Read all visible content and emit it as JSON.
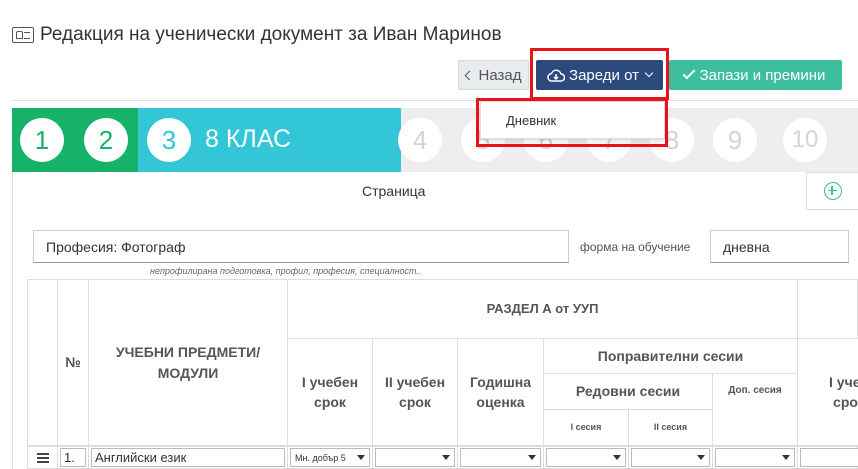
{
  "header": {
    "title": "Редакция на ученически документ за Иван Маринов",
    "title_icon": "id-card-icon"
  },
  "toolbar": {
    "back_label": "Назад",
    "load_label": "Зареди от",
    "save_label": "Запази и премини",
    "accent_save": "#3dbf9f",
    "accent_load": "#2d4a7c"
  },
  "dropdown": {
    "items": [
      "Дневник"
    ]
  },
  "steps": {
    "items": [
      "1",
      "2",
      "3",
      "4",
      "5",
      "6",
      "7",
      "8",
      "9",
      "10"
    ],
    "active_label": "8 КЛАС",
    "colors": {
      "done": "#17b26a",
      "active": "#33c6d6",
      "todo": "#eeeeee"
    }
  },
  "page": {
    "label": "Страница",
    "add_icon": "plus-circle-icon"
  },
  "form": {
    "profession_value": "Професия: Фотограф",
    "profession_hint": "непрофилирана подготовка, профил, професия, специалност..",
    "study_form_label": "форма на обучение",
    "study_form_value": "дневна"
  },
  "table": {
    "col_number": "№",
    "col_subjects": "УЧЕБНИ ПРЕДМЕТИ/ МОДУЛИ",
    "section_a": "РАЗДЕЛ А от УУП",
    "term1": "I учебен срок",
    "term2": "II учебен срок",
    "annual": "Годишна оценка",
    "corrective": "Поправителни сесии",
    "regular": "Редовни сесии",
    "extra_session": "Доп. сесия",
    "session1": "I сесия",
    "session2": "II сесия",
    "next_term1": "I учеб срок",
    "rows": [
      {
        "num": "1.",
        "subject": "Английски език",
        "term1": "Мн. добър 5"
      }
    ]
  }
}
